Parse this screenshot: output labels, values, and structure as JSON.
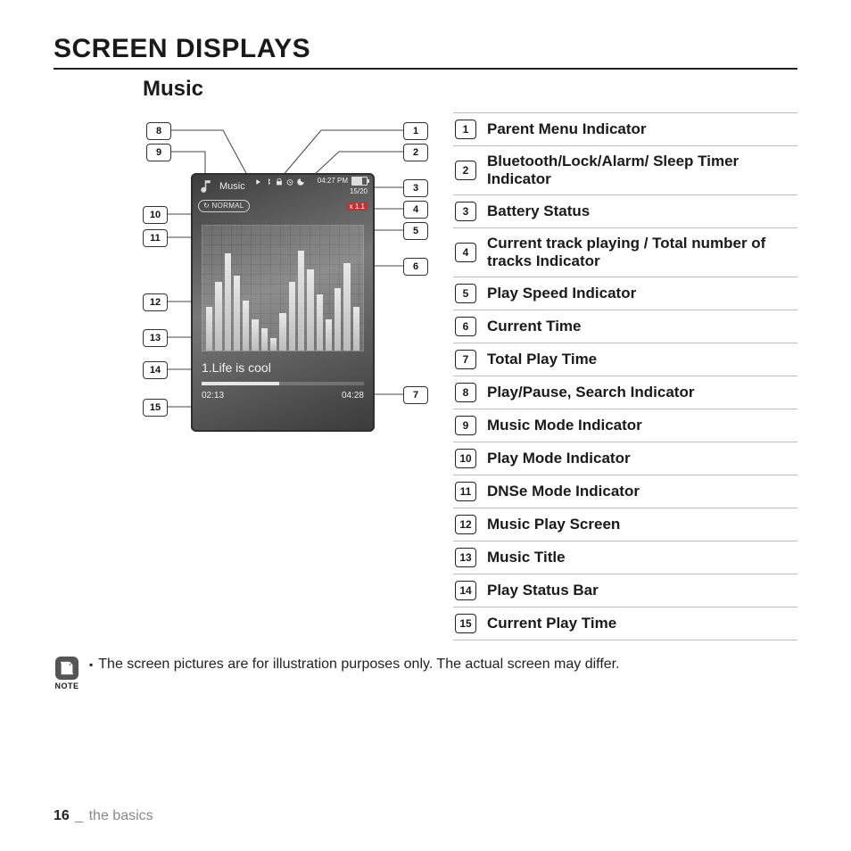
{
  "section_title": "SCREEN DISPLAYS",
  "subsection_title": "Music",
  "device": {
    "mode_label": "Music",
    "clock": "04:27 PM",
    "track_counter": "15/20",
    "dnse_label": "NORMAL",
    "speed_label": "x 1.1",
    "track_title": "1.Life is cool",
    "elapsed": "02:13",
    "total": "04:28"
  },
  "callouts": [
    "1",
    "2",
    "3",
    "4",
    "5",
    "6",
    "7",
    "8",
    "9",
    "10",
    "11",
    "12",
    "13",
    "14",
    "15"
  ],
  "legend": [
    {
      "n": "1",
      "label": "Parent Menu Indicator"
    },
    {
      "n": "2",
      "label": "Bluetooth/Lock/Alarm/ Sleep Timer Indicator"
    },
    {
      "n": "3",
      "label": "Battery Status"
    },
    {
      "n": "4",
      "label": "Current track playing / Total number of tracks Indicator"
    },
    {
      "n": "5",
      "label": "Play Speed Indicator"
    },
    {
      "n": "6",
      "label": "Current Time"
    },
    {
      "n": "7",
      "label": "Total Play Time"
    },
    {
      "n": "8",
      "label": "Play/Pause, Search Indicator"
    },
    {
      "n": "9",
      "label": "Music Mode Indicator"
    },
    {
      "n": "10",
      "label": "Play Mode Indicator"
    },
    {
      "n": "11",
      "label": "DNSe Mode Indicator"
    },
    {
      "n": "12",
      "label": "Music Play Screen"
    },
    {
      "n": "13",
      "label": "Music Title"
    },
    {
      "n": "14",
      "label": "Play Status Bar"
    },
    {
      "n": "15",
      "label": "Current Play Time"
    }
  ],
  "note_label": "NOTE",
  "note_text": "The screen pictures are for illustration purposes only. The actual screen may differ.",
  "footer": {
    "page": "16",
    "sep": "_",
    "chapter": "the basics"
  }
}
